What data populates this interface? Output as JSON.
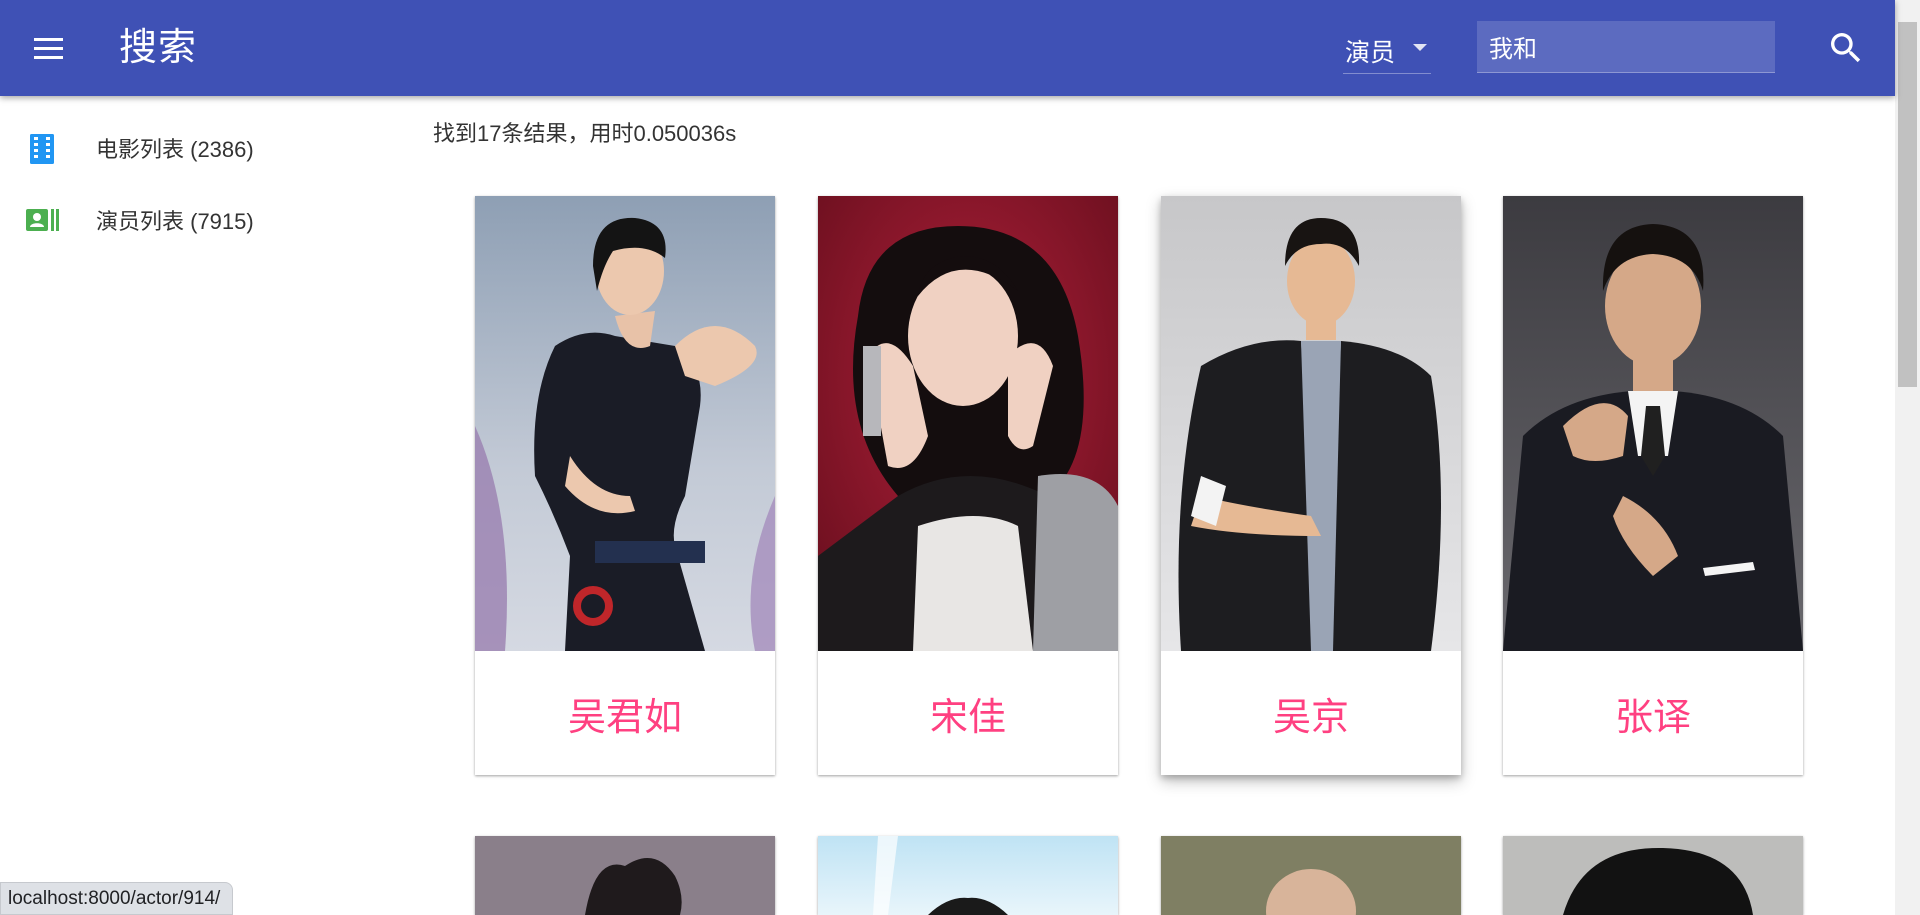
{
  "header": {
    "title": "搜索",
    "type_select": "演员",
    "search_value": "我和"
  },
  "sidebar": {
    "items": [
      {
        "label": "电影列表 (2386)",
        "icon": "movie-film-icon",
        "color": "#2196f3"
      },
      {
        "label": "演员列表 (7915)",
        "icon": "contact-card-icon",
        "color": "#4caf50"
      }
    ]
  },
  "results": {
    "summary": "找到17条结果，用时0.050036s",
    "cards": [
      {
        "name": "吴君如"
      },
      {
        "name": "宋佳"
      },
      {
        "name": "吴京"
      },
      {
        "name": "张译"
      },
      {
        "name": ""
      },
      {
        "name": ""
      },
      {
        "name": ""
      },
      {
        "name": ""
      }
    ]
  },
  "status_bar": {
    "url": "localhost:8000/actor/914/"
  },
  "colors": {
    "primary": "#3f51b5",
    "accent": "#ff4081",
    "search_bg": "#5c6bc0"
  }
}
